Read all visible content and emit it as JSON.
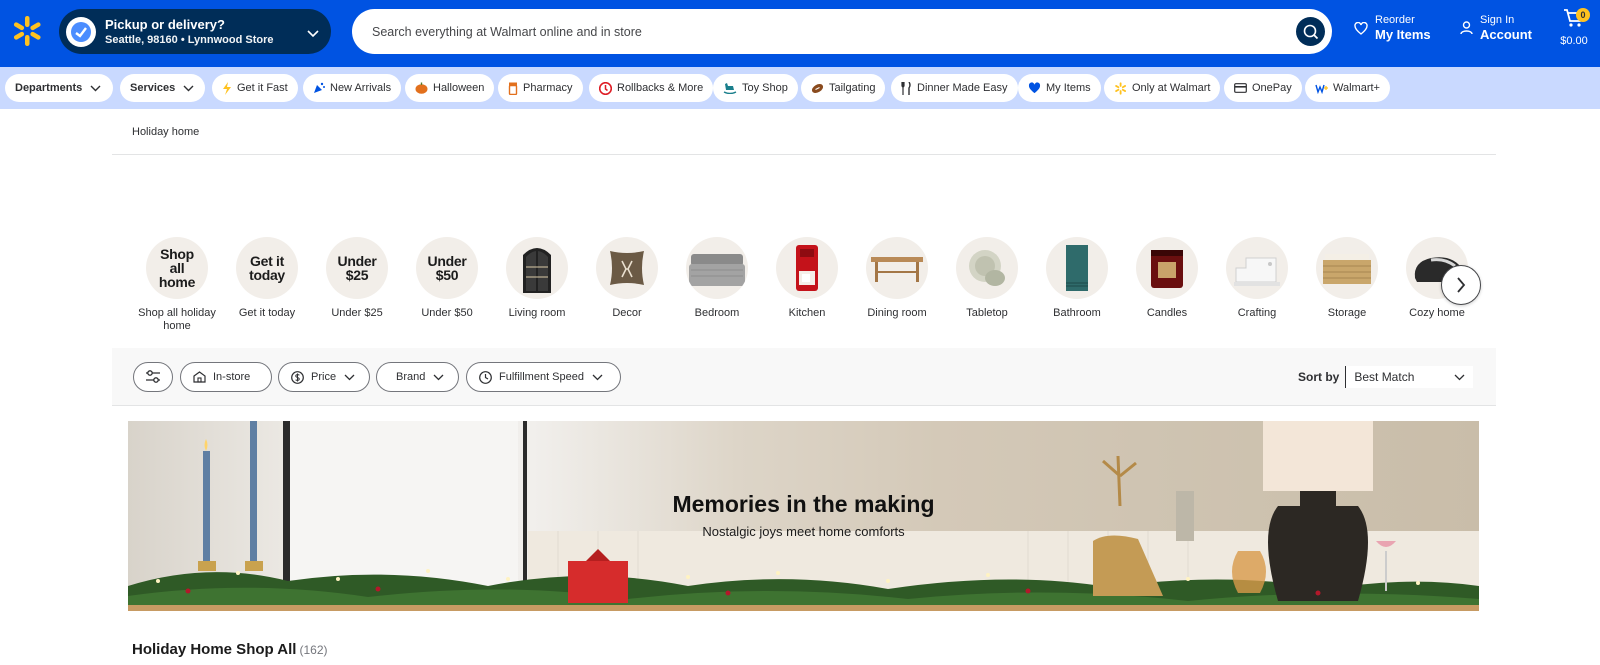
{
  "header": {
    "pickup_title": "Pickup or delivery?",
    "pickup_location": "Seattle, 98160 • Lynnwood Store",
    "search_placeholder": "Search everything at Walmart online and in store",
    "reorder_line1": "Reorder",
    "reorder_line2": "My Items",
    "signin_line1": "Sign In",
    "signin_line2": "Account",
    "cart_count": "0",
    "cart_total": "$0.00",
    "colors": {
      "bar": "#0053e2",
      "dark": "#002d58",
      "spark": "#ffc220"
    }
  },
  "nav": {
    "items": [
      {
        "label": "Departments",
        "icon": "chevron-down-icon"
      },
      {
        "label": "Services",
        "icon": "chevron-down-icon"
      },
      {
        "label": "Get it Fast",
        "icon": "lightning-icon"
      },
      {
        "label": "New Arrivals",
        "icon": "party-popper-icon"
      },
      {
        "label": "Halloween",
        "icon": "pumpkin-icon"
      },
      {
        "label": "Pharmacy",
        "icon": "pill-bottle-icon"
      },
      {
        "label": "Rollbacks & More",
        "icon": "rollback-icon"
      },
      {
        "label": "Toy Shop",
        "icon": "rocking-horse-icon"
      },
      {
        "label": "Tailgating",
        "icon": "football-icon"
      },
      {
        "label": "Dinner Made Easy",
        "icon": "utensils-icon"
      },
      {
        "label": "My Items",
        "icon": "heart-icon"
      },
      {
        "label": "Only at Walmart",
        "icon": "spark-icon"
      },
      {
        "label": "OnePay",
        "icon": "card-icon"
      },
      {
        "label": "Walmart+",
        "icon": "walmart-plus-icon"
      }
    ]
  },
  "breadcrumb": "Holiday home",
  "categories": {
    "items": [
      {
        "label": "Shop all holiday home",
        "circle_text": "Shop all home"
      },
      {
        "label": "Get it today",
        "circle_text": "Get it today"
      },
      {
        "label": "Under $25",
        "circle_text": "Under $25"
      },
      {
        "label": "Under $50",
        "circle_text": "Under $50"
      },
      {
        "label": "Living room",
        "icon": "cabinet-icon"
      },
      {
        "label": "Decor",
        "icon": "pillow-icon"
      },
      {
        "label": "Bedroom",
        "icon": "bed-icon"
      },
      {
        "label": "Kitchen",
        "icon": "coffee-maker-icon"
      },
      {
        "label": "Dining room",
        "icon": "table-icon"
      },
      {
        "label": "Tabletop",
        "icon": "plates-icon"
      },
      {
        "label": "Bathroom",
        "icon": "towel-icon"
      },
      {
        "label": "Candles",
        "icon": "candle-icon"
      },
      {
        "label": "Crafting",
        "icon": "sewing-machine-icon"
      },
      {
        "label": "Storage",
        "icon": "basket-icon"
      },
      {
        "label": "Cozy home",
        "icon": "slipper-icon"
      }
    ]
  },
  "filters": {
    "instore": "In-store",
    "price": "Price",
    "brand": "Brand",
    "fulfillment": "Fulfillment Speed",
    "sort_label": "Sort by",
    "sort_value": "Best Match"
  },
  "banner": {
    "headline": "Memories in the making",
    "subhead": "Nostalgic joys meet home comforts"
  },
  "results": {
    "title": "Holiday Home Shop All",
    "count": "(162)"
  }
}
